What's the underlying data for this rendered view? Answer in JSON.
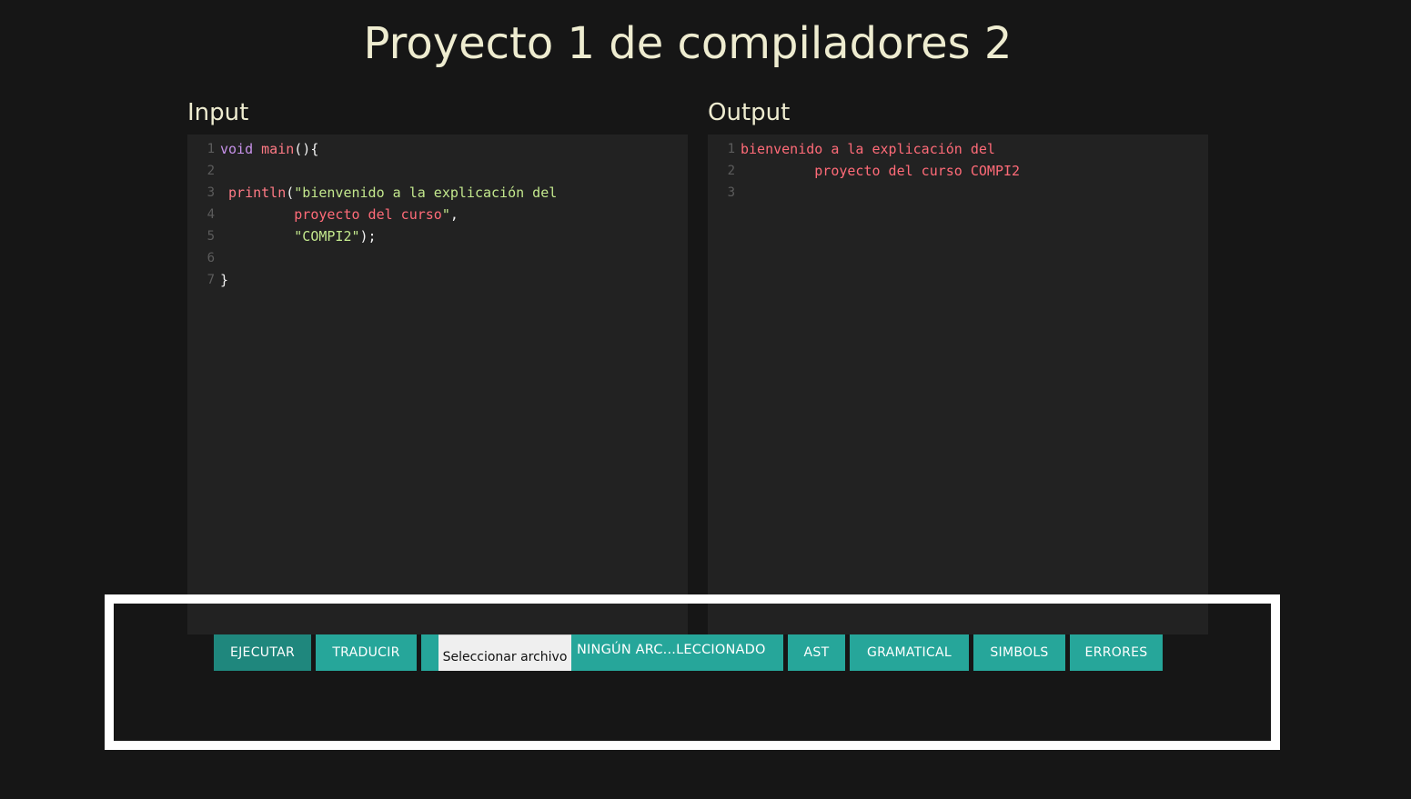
{
  "title": "Proyecto 1 de compiladores 2",
  "input": {
    "label": "Input",
    "lines": [
      {
        "n": "1",
        "segments": [
          [
            "kw",
            "void "
          ],
          [
            "fn",
            "main"
          ],
          [
            "plain",
            "(){"
          ]
        ]
      },
      {
        "n": "2",
        "segments": []
      },
      {
        "n": "3",
        "segments": [
          [
            "fn",
            " println"
          ],
          [
            "plain",
            "("
          ],
          [
            "str",
            "\"bienvenido a la explicación del"
          ]
        ]
      },
      {
        "n": "4",
        "segments": [
          [
            "strpart",
            "         proyecto del curso"
          ],
          [
            "str",
            "\""
          ],
          [
            "plain",
            ","
          ]
        ]
      },
      {
        "n": "5",
        "segments": [
          [
            "str",
            "         \"COMPI2\""
          ],
          [
            "plain",
            ");"
          ]
        ]
      },
      {
        "n": "6",
        "segments": []
      },
      {
        "n": "7",
        "segments": [
          [
            "plain",
            "}"
          ]
        ]
      }
    ]
  },
  "output": {
    "label": "Output",
    "lines": [
      {
        "n": "1",
        "text": "bienvenido a la explicación del"
      },
      {
        "n": "2",
        "text": "         proyecto del curso COMPI2"
      },
      {
        "n": "3",
        "text": ""
      }
    ]
  },
  "toolbar": {
    "ejecutar": "EJECUTAR",
    "traducir": "TRADUCIR",
    "file_button": "Seleccionar archivo",
    "file_status": "NINGÚN ARC...LECCIONADO",
    "ast": "AST",
    "gramatical": "GRAMATICAL",
    "simbols": "SIMBOLS",
    "errores": "ERRORES"
  },
  "colors": {
    "background": "#161616",
    "editor_bg": "#222222",
    "button": "#26a69a",
    "button_active": "#1f877d",
    "highlight_border": "#ffffff"
  }
}
